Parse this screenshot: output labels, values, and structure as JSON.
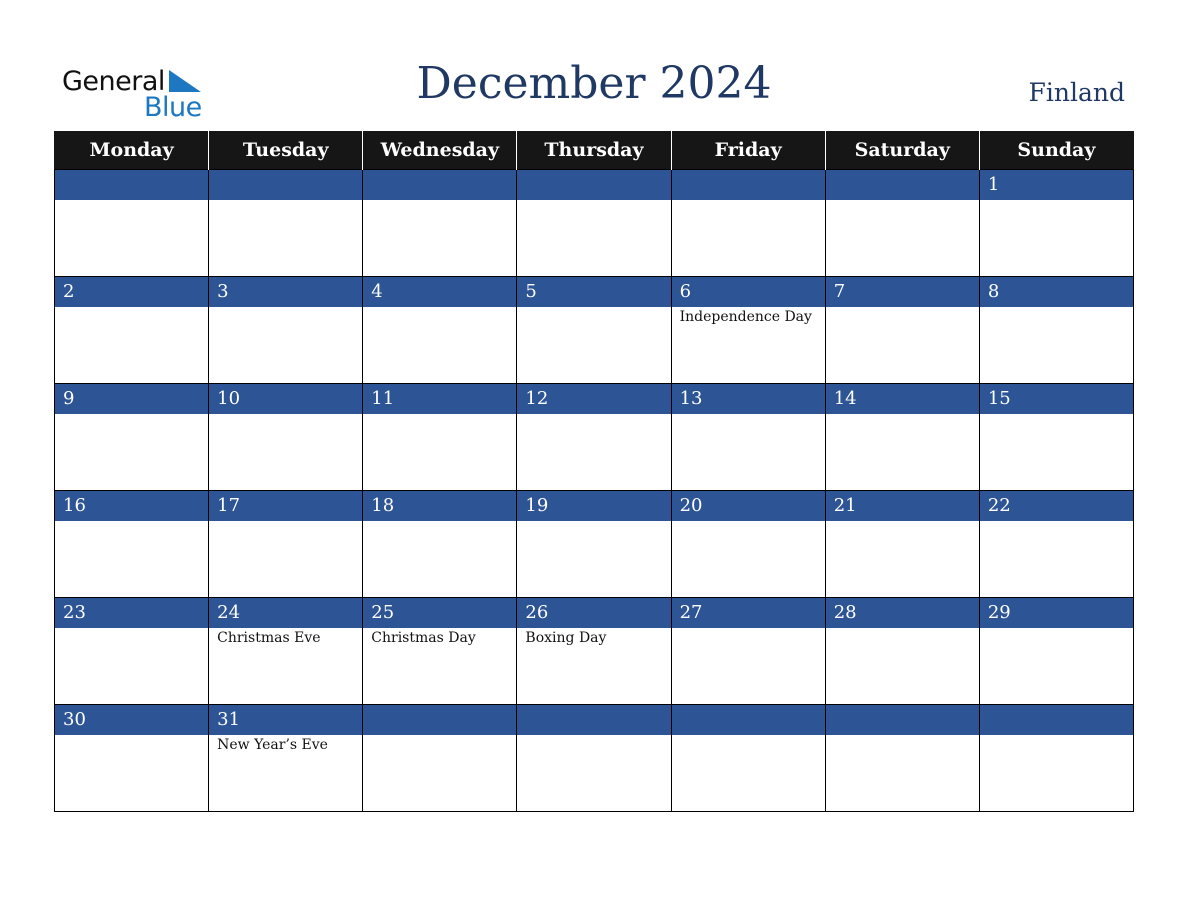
{
  "logo": {
    "line1": "General",
    "line2": "Blue"
  },
  "title": "December 2024",
  "country": "Finland",
  "weekdays": [
    "Monday",
    "Tuesday",
    "Wednesday",
    "Thursday",
    "Friday",
    "Saturday",
    "Sunday"
  ],
  "weeks": [
    [
      {
        "d": "",
        "h": ""
      },
      {
        "d": "",
        "h": ""
      },
      {
        "d": "",
        "h": ""
      },
      {
        "d": "",
        "h": ""
      },
      {
        "d": "",
        "h": ""
      },
      {
        "d": "",
        "h": ""
      },
      {
        "d": "1",
        "h": ""
      }
    ],
    [
      {
        "d": "2",
        "h": ""
      },
      {
        "d": "3",
        "h": ""
      },
      {
        "d": "4",
        "h": ""
      },
      {
        "d": "5",
        "h": ""
      },
      {
        "d": "6",
        "h": "Independence Day"
      },
      {
        "d": "7",
        "h": ""
      },
      {
        "d": "8",
        "h": ""
      }
    ],
    [
      {
        "d": "9",
        "h": ""
      },
      {
        "d": "10",
        "h": ""
      },
      {
        "d": "11",
        "h": ""
      },
      {
        "d": "12",
        "h": ""
      },
      {
        "d": "13",
        "h": ""
      },
      {
        "d": "14",
        "h": ""
      },
      {
        "d": "15",
        "h": ""
      }
    ],
    [
      {
        "d": "16",
        "h": ""
      },
      {
        "d": "17",
        "h": ""
      },
      {
        "d": "18",
        "h": ""
      },
      {
        "d": "19",
        "h": ""
      },
      {
        "d": "20",
        "h": ""
      },
      {
        "d": "21",
        "h": ""
      },
      {
        "d": "22",
        "h": ""
      }
    ],
    [
      {
        "d": "23",
        "h": ""
      },
      {
        "d": "24",
        "h": "Christmas Eve"
      },
      {
        "d": "25",
        "h": "Christmas Day"
      },
      {
        "d": "26",
        "h": "Boxing Day"
      },
      {
        "d": "27",
        "h": ""
      },
      {
        "d": "28",
        "h": ""
      },
      {
        "d": "29",
        "h": ""
      }
    ],
    [
      {
        "d": "30",
        "h": ""
      },
      {
        "d": "31",
        "h": "New Year’s Eve"
      },
      {
        "d": "",
        "h": ""
      },
      {
        "d": "",
        "h": ""
      },
      {
        "d": "",
        "h": ""
      },
      {
        "d": "",
        "h": ""
      },
      {
        "d": "",
        "h": ""
      }
    ]
  ]
}
